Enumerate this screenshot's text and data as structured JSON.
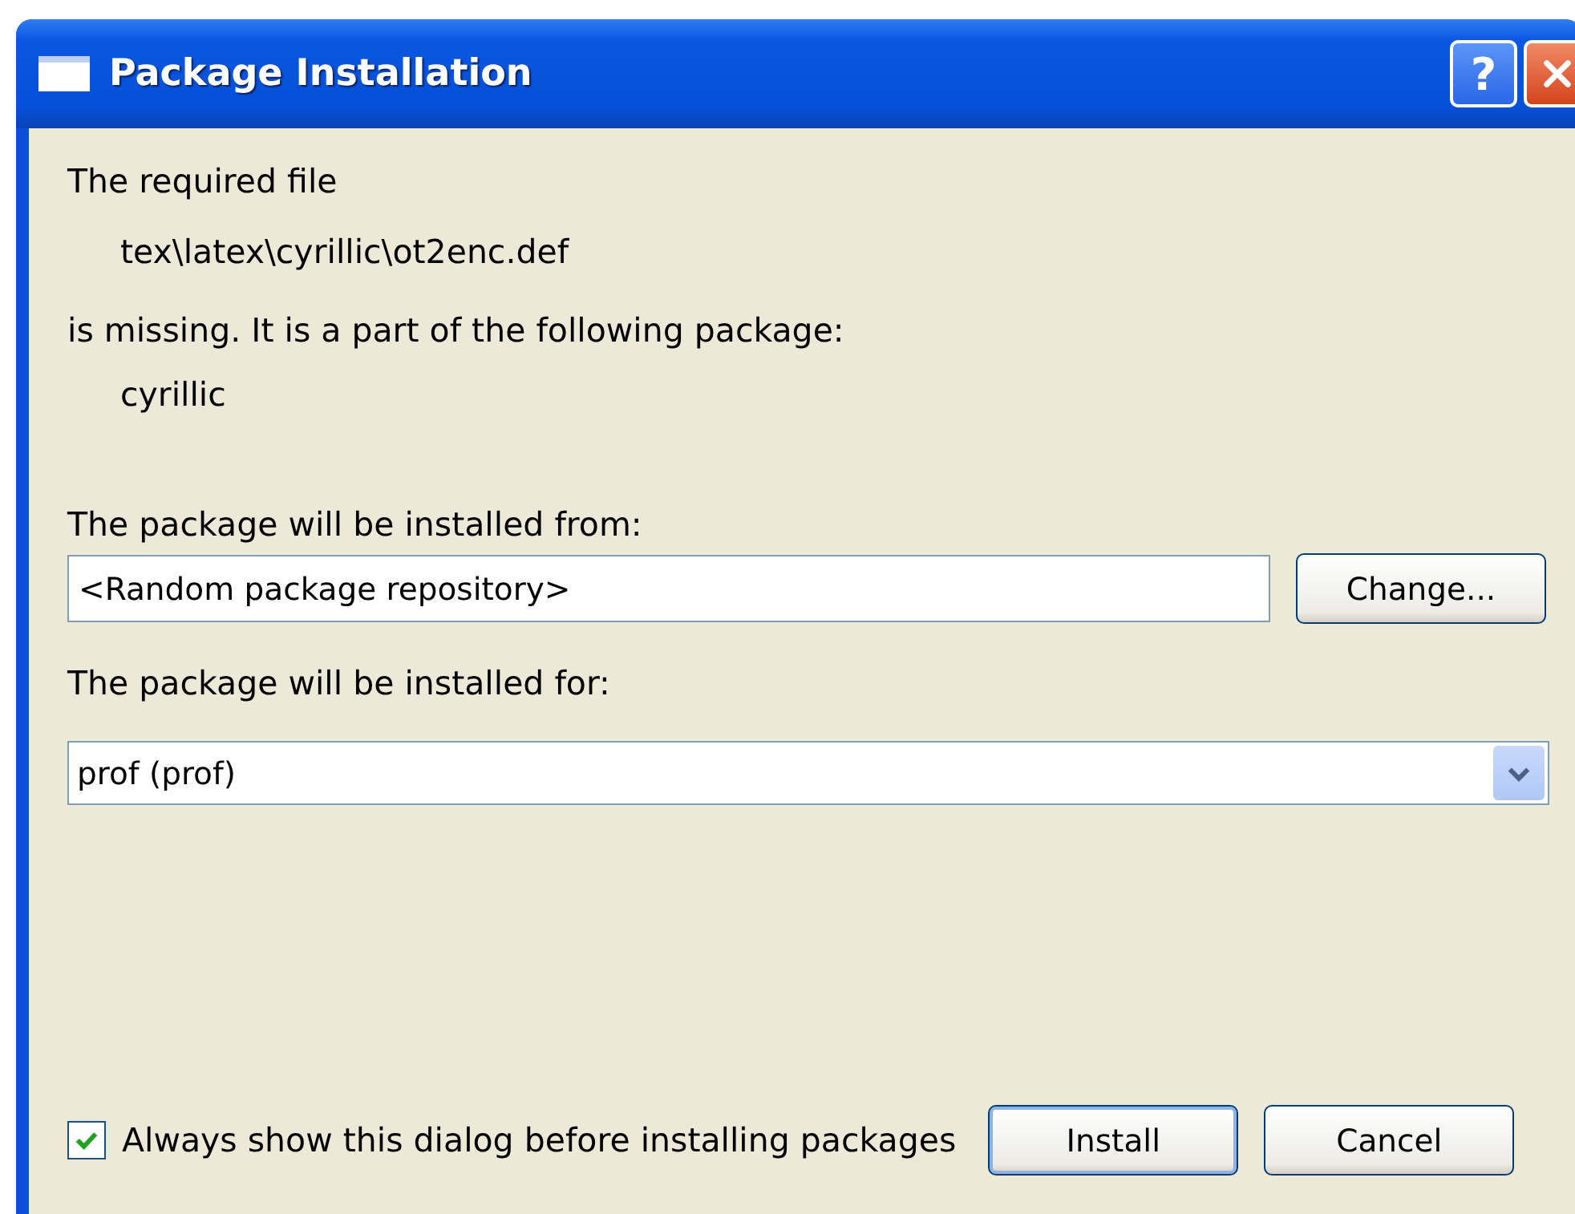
{
  "window": {
    "title": "Package Installation",
    "buttons": [
      "?"
    ]
  },
  "message": {
    "intro": "The required file",
    "file": "tex\\latex\\cyrillic\\ot2enc.def",
    "missing": "is missing. It is a part of the following package:",
    "package": "cyrillic"
  },
  "source": {
    "label": "The package will be installed from:",
    "value": "<Random package repository>",
    "button": "Change..."
  },
  "target": {
    "label": "The package will be installed for:",
    "value": "prof (prof)"
  },
  "always_show": {
    "label": "Always show this dialog before installing packages",
    "checked": true
  },
  "buttons": [
    {
      "label": "Install",
      "default": true
    },
    {
      "label": "Cancel",
      "default": false
    }
  ]
}
